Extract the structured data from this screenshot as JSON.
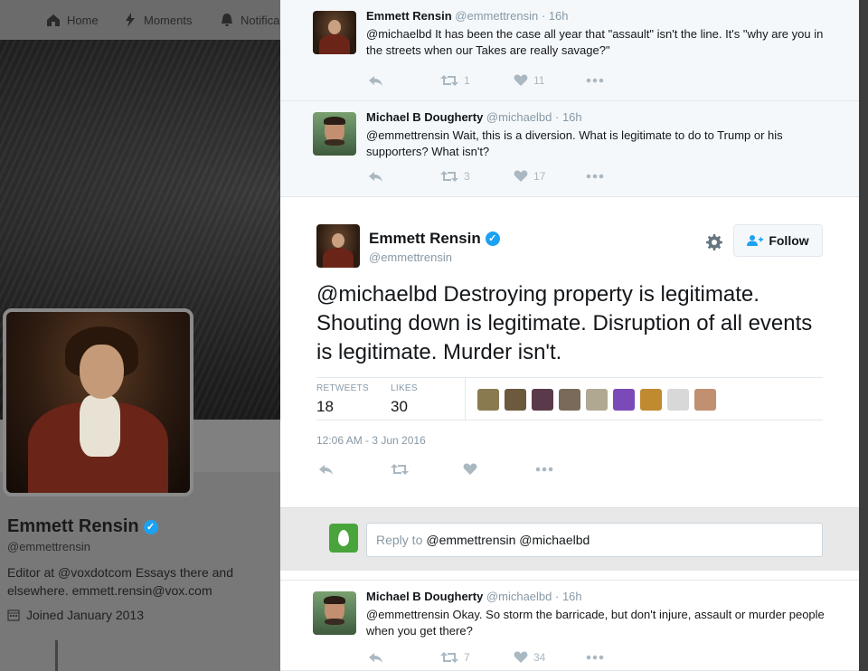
{
  "nav": {
    "home": "Home",
    "moments": "Moments",
    "notifications": "Notifica"
  },
  "profile": {
    "name": "Emmett Rensin",
    "handle": "@emmettrensin",
    "bio": "Editor at @voxdotcom Essays there and elsewhere. emmett.rensin@vox.com",
    "joined": "Joined January 2013"
  },
  "replies_above": [
    {
      "name": "Emmett Rensin",
      "handle": "@emmettrensin",
      "time": "· 16h",
      "text": "@michaelbd It has been the case all year that \"assault\" isn't the line. It's \"why are you in the streets when our Takes are really savage?\"",
      "retweets": "1",
      "likes": "11"
    },
    {
      "name": "Michael B Dougherty",
      "handle": "@michaelbd",
      "time": "· 16h",
      "text": "@emmettrensin Wait, this is a diversion. What is legitimate to do to Trump or his supporters? What isn't?",
      "retweets": "3",
      "likes": "17"
    }
  ],
  "main_tweet": {
    "name": "Emmett Rensin",
    "handle": "@emmettrensin",
    "follow_label": "Follow",
    "text": "@michaelbd Destroying property is legitimate. Shouting down is legitimate. Disruption of all events is legitimate. Murder isn't.",
    "retweets_label": "RETWEETS",
    "retweets": "18",
    "likes_label": "LIKES",
    "likes": "30",
    "timestamp": "12:06 AM - 3 Jun 2016",
    "liker_colors": [
      "#8a7a50",
      "#6b5a3c",
      "#5a3a4a",
      "#7a6a5a",
      "#b0a890",
      "#7a4ab8",
      "#c08a30",
      "#d8d8d8",
      "#c09070"
    ]
  },
  "reply_box": {
    "placeholder": "Reply to",
    "mentions": "@emmettrensin @michaelbd"
  },
  "replies_below": [
    {
      "name": "Michael B Dougherty",
      "handle": "@michaelbd",
      "time": "· 16h",
      "text": "@emmettrensin Okay. So storm the barricade, but don't injure, assault or murder people when you get there?",
      "retweets": "7",
      "likes": "34"
    }
  ]
}
